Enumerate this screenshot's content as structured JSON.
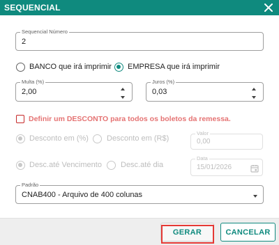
{
  "dialog": {
    "title": "SEQUENCIAL",
    "close_icon": "close-icon"
  },
  "sequencial": {
    "label": "Sequencial Número",
    "value": "2"
  },
  "impressao": {
    "option_banco": "BANCO que irá imprimir",
    "option_empresa": "EMPRESA que irá imprimir",
    "selected": "empresa"
  },
  "multa": {
    "label": "Multa (%)",
    "value": "2,00"
  },
  "juros": {
    "label": "Juros (%)",
    "value": "0,03"
  },
  "desconto": {
    "checkbox_label": "Definir um DESCONTO para todos os boletos da remessa.",
    "checked": false,
    "option_percent": "Desconto em (%)",
    "option_reais": "Desconto em (R$)",
    "valor_label": "Valor",
    "valor_value": "0,00",
    "option_vencimento": "Desc.até Vencimento",
    "option_dia": "Desc.até dia",
    "data_label": "Data",
    "data_value": "15/01/2026"
  },
  "padrao": {
    "label": "Padrão",
    "value": "CNAB400 - Arquivo de 400 colunas"
  },
  "footer": {
    "gerar_label": "GERAR",
    "cancelar_label": "CANCELAR"
  },
  "colors": {
    "primary": "#0f8a7e",
    "highlight_red": "#e53935",
    "checkbox_label": "#e57373"
  }
}
